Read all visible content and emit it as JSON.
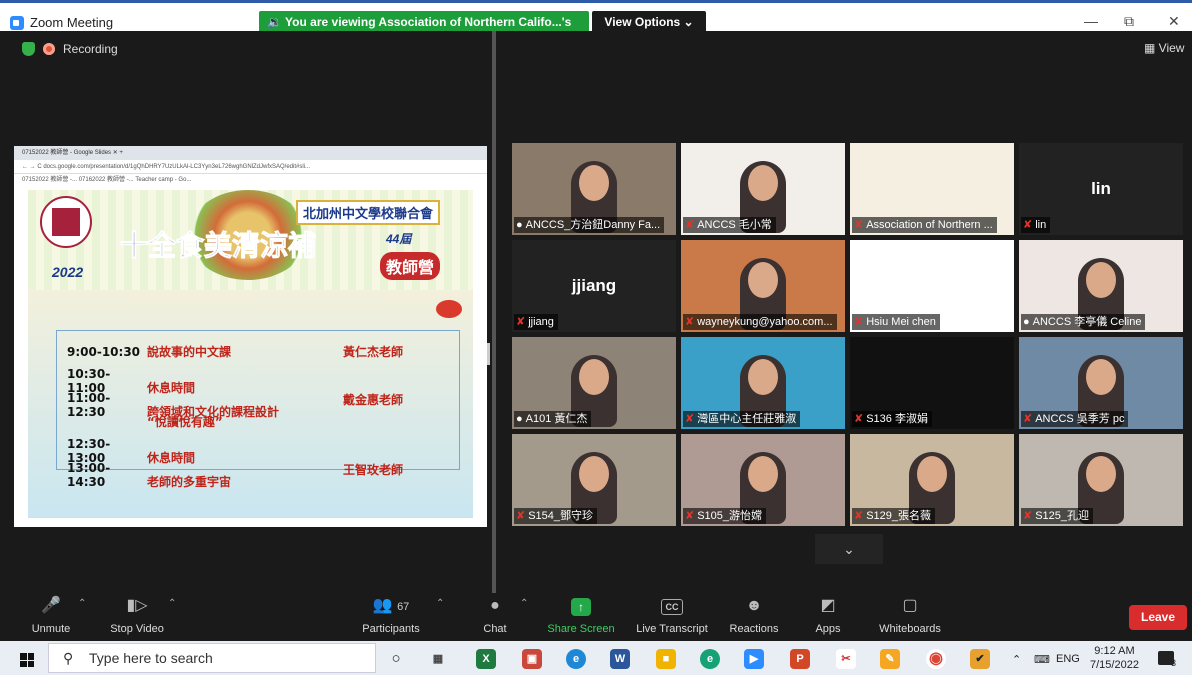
{
  "window": {
    "title": "Zoom Meeting",
    "banner": "🔉 You are viewing Association of Northern Califo...'s screen",
    "view_options": "View Options ⌄",
    "minimize": "—",
    "restore": "⧉",
    "close": "✕"
  },
  "meeting": {
    "recording_label": "Recording",
    "view_label": "▦ View"
  },
  "shared_screen": {
    "browser_tab": "07152022 教師營 - Google Slides ✕   +",
    "browser_url": "← → C  docs.google.com/presentation/d/1gQhDHRY7UzULkAl-LC3Yyn3eL726wghGNlZdJwfxSAQ/edit#sli...",
    "bookmarks": "07152022 教師營 -...   07162022 教師營 -...   Teacher camp - Go...",
    "school_name": "北加州中文學校聯合會",
    "title": "十全食美清涼補",
    "year": "2022",
    "edition": "44屆",
    "camp": "教師營",
    "schedule": [
      {
        "time": "9:00-10:30",
        "course": "說故事的中文課",
        "teacher": "黃仁杰老師"
      },
      {
        "time": "10:30-11:00",
        "course": "休息時間",
        "teacher": ""
      },
      {
        "time": "11:00-12:30",
        "course": "跨領域和文化的課程設計",
        "teacher": "戴金惠老師"
      },
      {
        "time": "",
        "course": "“悅讀悅有趣”",
        "teacher": ""
      },
      {
        "time": "12:30-13:00",
        "course": "休息時間",
        "teacher": ""
      },
      {
        "time": "13:00-14:30",
        "course": "老師的多重宇宙",
        "teacher": "王智玫老師"
      }
    ]
  },
  "participants": [
    {
      "name": "ANCCS_方治鈕Danny Fa...",
      "muted": false,
      "big": "",
      "bg": "#8a7a6a",
      "video": true,
      "active": true
    },
    {
      "name": "ANCCS 毛小常",
      "muted": true,
      "big": "",
      "bg": "#f2eeea",
      "video": true,
      "active": false
    },
    {
      "name": "Association of Northern ...",
      "muted": true,
      "big": "",
      "bg": "#f4efe0",
      "video": false,
      "active": false
    },
    {
      "name": "lin",
      "muted": true,
      "big": "lin",
      "bg": "#222222",
      "video": false,
      "active": false
    },
    {
      "name": "jjiang",
      "muted": true,
      "big": "jjiang",
      "bg": "#222222",
      "video": false,
      "active": false
    },
    {
      "name": "wayneykung@yahoo.com...",
      "muted": true,
      "big": "",
      "bg": "#c97a48",
      "video": true,
      "active": false
    },
    {
      "name": "Hsiu Mei chen",
      "muted": true,
      "big": "",
      "bg": "#ffffff",
      "video": false,
      "active": false
    },
    {
      "name": "ANCCS 李亭儀 Celine",
      "muted": false,
      "big": "",
      "bg": "#eee6e2",
      "video": true,
      "active": false
    },
    {
      "name": "A101 黃仁杰",
      "muted": false,
      "big": "",
      "bg": "#8e8377",
      "video": true,
      "active": false
    },
    {
      "name": "灣區中心主任莊雅淑",
      "muted": true,
      "big": "",
      "bg": "#3aa0c8",
      "video": true,
      "active": false
    },
    {
      "name": "S136 李淑娟",
      "muted": true,
      "big": "",
      "bg": "#111111",
      "video": false,
      "active": false
    },
    {
      "name": "ANCCS 吳季芳 pc",
      "muted": true,
      "big": "",
      "bg": "#6f8aa4",
      "video": true,
      "active": false
    },
    {
      "name": "S154_鄧守珍",
      "muted": true,
      "big": "",
      "bg": "#a39a8c",
      "video": true,
      "active": false
    },
    {
      "name": "S105_游怡嫦",
      "muted": true,
      "big": "",
      "bg": "#b09a94",
      "video": true,
      "active": false
    },
    {
      "name": "S129_張名薇",
      "muted": true,
      "big": "",
      "bg": "#c9b8a0",
      "video": true,
      "active": false
    },
    {
      "name": "S125_孔迎",
      "muted": true,
      "big": "",
      "bg": "#bfb8b0",
      "video": true,
      "active": false
    }
  ],
  "toolbar": {
    "unmute": "Unmute",
    "stop_video": "Stop Video",
    "participants": "Participants",
    "participants_count": "67",
    "chat": "Chat",
    "share_screen": "Share Screen",
    "live_transcript": "Live Transcript",
    "reactions": "Reactions",
    "apps": "Apps",
    "whiteboards": "Whiteboards",
    "leave": "Leave",
    "cc": "CC"
  },
  "taskbar": {
    "search_placeholder": "Type here to search",
    "language": "ENG",
    "time": "9:12 AM",
    "date": "7/15/2022",
    "notifications": "3"
  },
  "colors": {
    "banner": "#1d9e3a",
    "leave": "#d92c2c",
    "share": "#23a84a",
    "active_speaker": "#d4e04b"
  }
}
